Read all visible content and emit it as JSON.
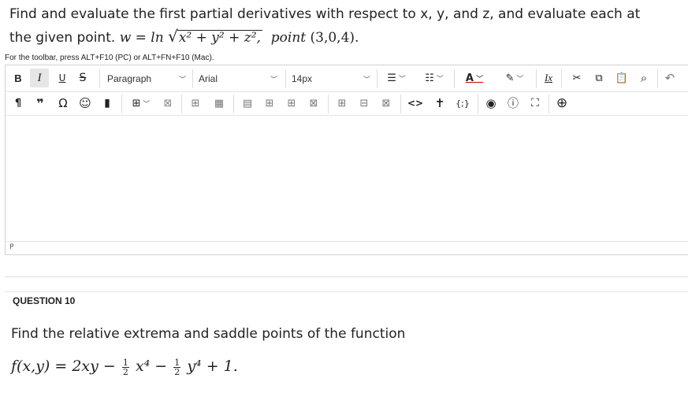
{
  "question9": {
    "line1": "Find and evaluate the first partial derivatives with respect to x, y, and z, and evaluate each at",
    "line2": "the given point.",
    "formula_lhs": "w = ln",
    "formula_radicand": "x² + y² + z²,",
    "point_label": "point",
    "point_value": "(3,0,4)."
  },
  "editor": {
    "toolbar_hint": "For the toolbar, press ALT+F10 (PC) or ALT+FN+F10 (Mac).",
    "block_format": "Paragraph",
    "font_family": "Arial",
    "font_size": "14px",
    "status_path": "P",
    "toolbar_row1": [
      "B",
      "I",
      "U",
      "S"
    ],
    "icons_row1": [
      "bold-icon",
      "italic-icon",
      "underline-icon",
      "strikethrough-icon",
      "bullet-list-icon",
      "numbered-list-icon",
      "text-color-icon",
      "highlight-icon",
      "clear-formatting-icon",
      "cut-icon",
      "copy-icon",
      "paste-icon",
      "find-icon",
      "undo-icon"
    ],
    "icons_row2": [
      "paragraph-mark-icon",
      "blockquote-icon",
      "omega-icon",
      "emoji-icon",
      "bookmark-icon",
      "table-icon",
      "delete-table-icon",
      "row-props-icon",
      "cell-props-icon",
      "insert-row-icon",
      "insert-col-icon",
      "merge-icon",
      "split-icon",
      "code-icon",
      "accessibility-icon",
      "source-icon",
      "preview-icon",
      "help-icon",
      "fullscreen-icon",
      "add-content-icon"
    ]
  },
  "question10": {
    "label": "QUESTION 10",
    "text": "Find the relative extrema and saddle points of the function",
    "formula_start": "f(x,y) = 2xy −",
    "frac1_num": "1",
    "frac1_den": "2",
    "term1": "x⁴ −",
    "frac2_num": "1",
    "frac2_den": "2",
    "term2": "y⁴ + 1."
  }
}
